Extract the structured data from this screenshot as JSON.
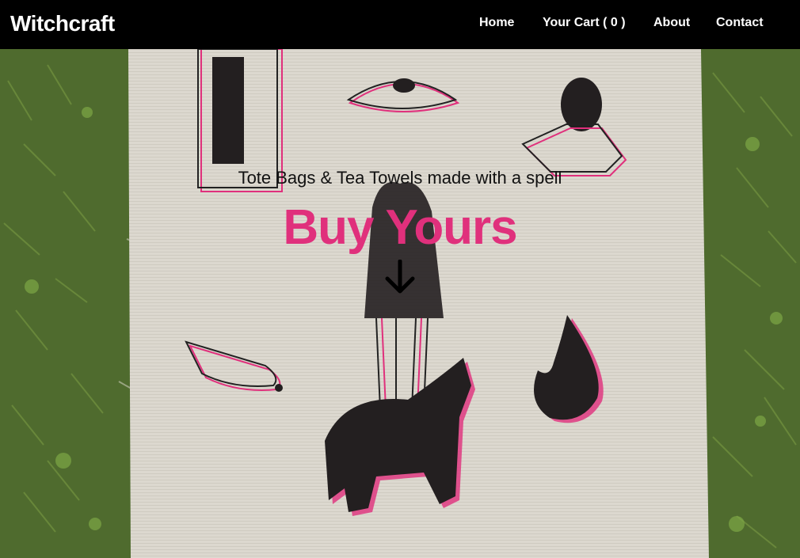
{
  "header": {
    "brand": "Witchcraft",
    "nav": {
      "home": "Home",
      "cart": "Your Cart ( 0 )",
      "about": "About",
      "contact": "Contact"
    }
  },
  "hero": {
    "subtitle": "Tote Bags & Tea Towels made with a spell",
    "title": "Buy Yours",
    "scroll_icon": "arrow-down-icon",
    "image": "printed tote bag lying on grass"
  },
  "colors": {
    "navbar": "#000000",
    "nav_text": "#ffffff",
    "accent": "#e0307c",
    "grass": "#4f6b2e",
    "fabric": "#dcd8cf"
  }
}
